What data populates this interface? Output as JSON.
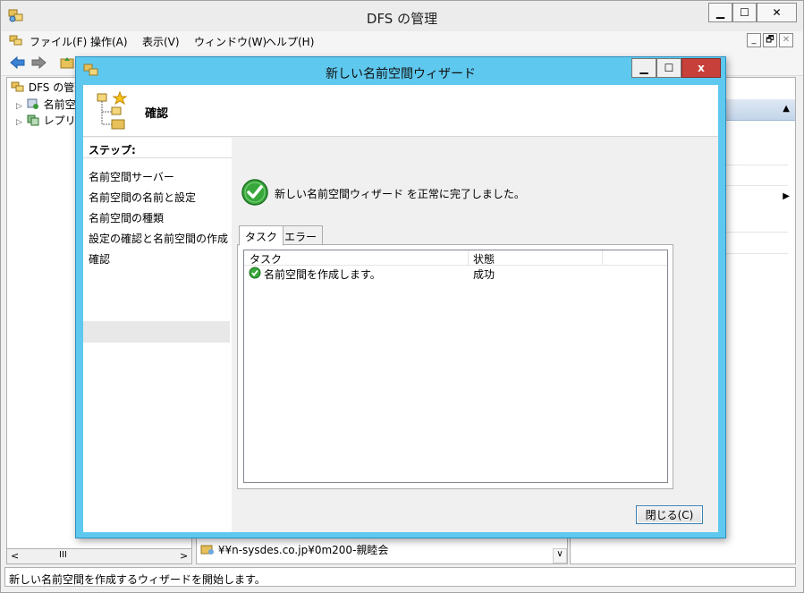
{
  "main": {
    "title": "DFS の管理",
    "menu": [
      "ファイル(F)",
      "操作(A)",
      "表示(V)",
      "ウィンドウ(W)",
      "ヘルプ(H)"
    ],
    "caption_buttons": [
      "▁",
      "☐",
      "✕"
    ],
    "mdi_buttons": [
      "_",
      "🗗",
      "✕"
    ],
    "tree": {
      "root": "DFS の管理",
      "items": [
        "名前空",
        "レプリケ"
      ]
    },
    "center_list": {
      "row": "¥¥n-sysdes.co.jp¥0m200-親睦会"
    },
    "scrollbar_label": "III",
    "status_text": "新しい名前空間を作成するウィザードを開始します。"
  },
  "wizard": {
    "title": "新しい名前空間ウィザード",
    "caption_buttons": [
      "▁",
      "☐",
      "x"
    ],
    "header_title": "確認",
    "steps_heading": "ステップ:",
    "steps": [
      "名前空間サーバー",
      "名前空間の名前と設定",
      "名前空間の種類",
      "設定の確認と名前空間の作成",
      "確認"
    ],
    "success_message": "新しい名前空間ウィザード を正常に完了しました。",
    "tabs": [
      "タスク",
      "エラー"
    ],
    "columns": [
      "タスク",
      "状態"
    ],
    "rows": [
      {
        "task": "名前空間を作成します。",
        "status": "成功"
      }
    ],
    "close_button": "閉じる(C)"
  },
  "colors": {
    "wizard_frame": "#5ec8ee",
    "close_caption": "#c7403a",
    "success_green": "#39a83c"
  }
}
